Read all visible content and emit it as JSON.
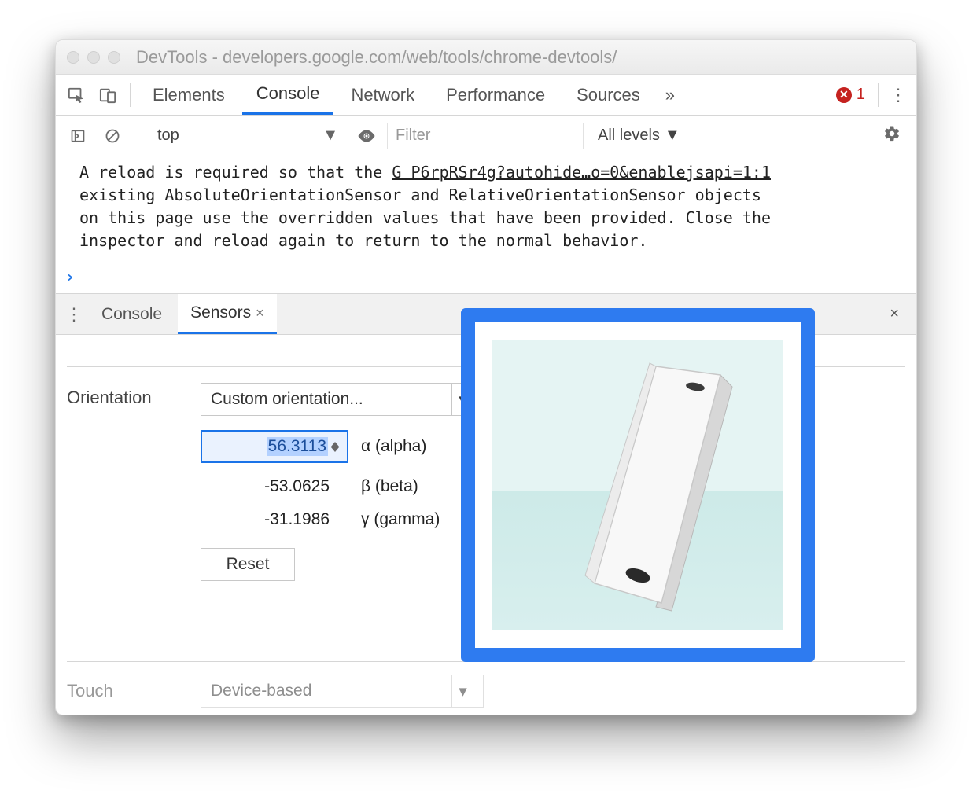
{
  "window": {
    "title": "DevTools - developers.google.com/web/tools/chrome-devtools/"
  },
  "tabs": {
    "elements": "Elements",
    "console": "Console",
    "network": "Network",
    "performance": "Performance",
    "sources": "Sources",
    "more": "»",
    "error_count": "1"
  },
  "consoleToolbar": {
    "context": "top",
    "filter_placeholder": "Filter",
    "levels_label": "All levels"
  },
  "consoleMessage": {
    "l1_a": "A reload is required so that the ",
    "src": "G P6rpRSr4g?autohide…o=0&enablejsapi=1:1",
    "l2": "existing AbsoluteOrientationSensor and RelativeOrientationSensor objects",
    "l3": "on this page use the overridden values that have been provided. Close the",
    "l4": "inspector and reload again to return to the normal behavior.",
    "prompt": "›"
  },
  "drawer": {
    "tab_console": "Console",
    "tab_sensors": "Sensors",
    "close_x": "×"
  },
  "sensors": {
    "orientation_label": "Orientation",
    "orientation_select": "Custom orientation...",
    "alpha_value": "56.3113",
    "alpha_label": "α (alpha)",
    "beta_value": "-53.0625",
    "beta_label": "β (beta)",
    "gamma_value": "-31.1986",
    "gamma_label": "γ (gamma)",
    "reset": "Reset",
    "touch_label": "Touch",
    "touch_select": "Device-based"
  }
}
